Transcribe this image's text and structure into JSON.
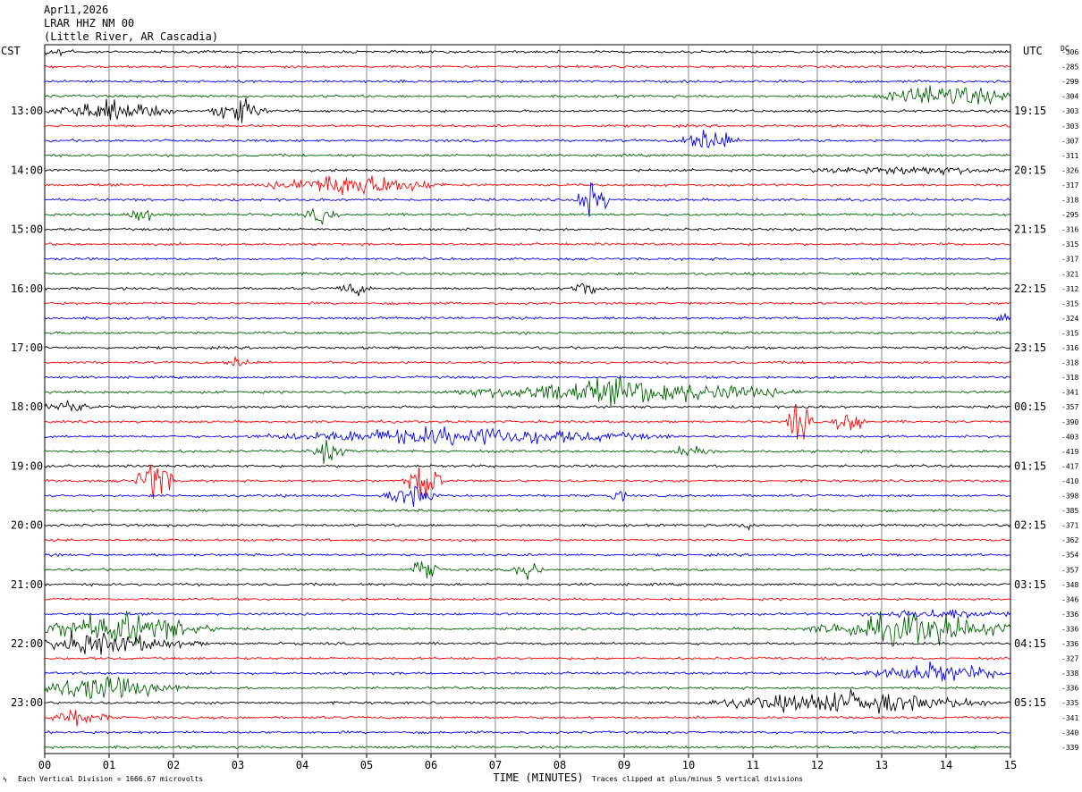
{
  "header": {
    "date": "Apr11,2026",
    "station": "LRAR HHZ NM 00",
    "location": "(Little River, AR Cascadia)"
  },
  "left_label": "CST",
  "right_label": "UTC",
  "dc_label": "DC",
  "footer": {
    "scale_note": "Each Vertical Division = 1666.67 microvolts",
    "clip_note": "Traces clipped at plus/minus 5 vertical divisions"
  },
  "chart_data": {
    "type": "line",
    "title": "Apr11,2026 LRAR HHZ NM 00 (Little River, AR Cascadia)",
    "xlabel": "TIME (MINUTES)",
    "x_ticks": [
      "00",
      "01",
      "02",
      "03",
      "04",
      "05",
      "06",
      "07",
      "08",
      "09",
      "10",
      "11",
      "12",
      "13",
      "14",
      "15"
    ],
    "xlim": [
      0,
      15
    ],
    "grid": true,
    "trace_colors": [
      "#000000",
      "#ff0000",
      "#0000ff",
      "#006400"
    ],
    "left_time_labels": [
      "13:00",
      "14:00",
      "15:00",
      "16:00",
      "17:00",
      "18:00",
      "19:00",
      "20:00",
      "21:00",
      "22:00",
      "23:00"
    ],
    "right_time_labels": [
      "19:15",
      "20:15",
      "21:15",
      "22:15",
      "23:15",
      "00:15",
      "01:15",
      "02:15",
      "03:15",
      "04:15",
      "05:15"
    ],
    "dc_offsets": [
      "-306",
      "-285",
      "-299",
      "-304",
      "-303",
      "-303",
      "-307",
      "-311",
      "-326",
      "-317",
      "-318",
      "-295",
      "-316",
      "-315",
      "-317",
      "-321",
      "-312",
      "-315",
      "-324",
      "-315",
      "-316",
      "-318",
      "-318",
      "-341",
      "-357",
      "-390",
      "-403",
      "-419",
      "-417",
      "-410",
      "-398",
      "-385",
      "-371",
      "-362",
      "-354",
      "-357",
      "-348",
      "-346",
      "-336",
      "-336",
      "-336",
      "-327",
      "-338",
      "-336",
      "-335",
      "-341",
      "-340",
      "-339"
    ],
    "events": [
      {
        "trace": 0,
        "minute": 0.2,
        "amp": 0.35,
        "width": 0.3
      },
      {
        "trace": 3,
        "minute": 14.0,
        "amp": 0.8,
        "width": 1.2
      },
      {
        "trace": 4,
        "minute": 1.0,
        "amp": 0.7,
        "width": 1.2
      },
      {
        "trace": 4,
        "minute": 3.0,
        "amp": 0.9,
        "width": 0.5
      },
      {
        "trace": 6,
        "minute": 10.3,
        "amp": 1.0,
        "width": 0.5
      },
      {
        "trace": 8,
        "minute": 13.5,
        "amp": 0.25,
        "width": 2.0
      },
      {
        "trace": 9,
        "minute": 4.8,
        "amp": 0.8,
        "width": 1.5
      },
      {
        "trace": 10,
        "minute": 8.5,
        "amp": 1.6,
        "width": 0.3
      },
      {
        "trace": 11,
        "minute": 1.5,
        "amp": 0.55,
        "width": 0.3
      },
      {
        "trace": 11,
        "minute": 4.3,
        "amp": 0.55,
        "width": 0.3
      },
      {
        "trace": 16,
        "minute": 4.8,
        "amp": 0.5,
        "width": 0.3
      },
      {
        "trace": 16,
        "minute": 8.4,
        "amp": 0.6,
        "width": 0.3
      },
      {
        "trace": 18,
        "minute": 14.9,
        "amp": 0.45,
        "width": 0.15
      },
      {
        "trace": 21,
        "minute": 3.0,
        "amp": 0.45,
        "width": 0.25
      },
      {
        "trace": 23,
        "minute": 9.0,
        "amp": 0.85,
        "width": 3.0
      },
      {
        "trace": 24,
        "minute": 0.3,
        "amp": 0.45,
        "width": 0.5
      },
      {
        "trace": 25,
        "minute": 11.7,
        "amp": 1.6,
        "width": 0.25
      },
      {
        "trace": 25,
        "minute": 12.5,
        "amp": 1.0,
        "width": 0.3
      },
      {
        "trace": 26,
        "minute": 6.5,
        "amp": 0.6,
        "width": 3.5
      },
      {
        "trace": 27,
        "minute": 4.4,
        "amp": 0.7,
        "width": 0.35
      },
      {
        "trace": 27,
        "minute": 10.1,
        "amp": 0.6,
        "width": 0.35
      },
      {
        "trace": 29,
        "minute": 1.7,
        "amp": 1.7,
        "width": 0.35
      },
      {
        "trace": 29,
        "minute": 5.9,
        "amp": 1.4,
        "width": 0.35
      },
      {
        "trace": 30,
        "minute": 5.7,
        "amp": 0.7,
        "width": 0.5
      },
      {
        "trace": 30,
        "minute": 8.9,
        "amp": 0.35,
        "width": 0.2
      },
      {
        "trace": 32,
        "minute": 10.9,
        "amp": 0.25,
        "width": 0.15
      },
      {
        "trace": 35,
        "minute": 5.9,
        "amp": 1.0,
        "width": 0.25
      },
      {
        "trace": 35,
        "minute": 7.5,
        "amp": 0.6,
        "width": 0.3
      },
      {
        "trace": 38,
        "minute": 14.0,
        "amp": 0.3,
        "width": 1.5
      },
      {
        "trace": 39,
        "minute": 1.2,
        "amp": 1.1,
        "width": 1.6
      },
      {
        "trace": 39,
        "minute": 13.5,
        "amp": 1.1,
        "width": 1.8
      },
      {
        "trace": 40,
        "minute": 0.8,
        "amp": 0.7,
        "width": 1.8
      },
      {
        "trace": 42,
        "minute": 13.8,
        "amp": 0.6,
        "width": 1.4
      },
      {
        "trace": 43,
        "minute": 0.8,
        "amp": 0.8,
        "width": 1.5
      },
      {
        "trace": 44,
        "minute": 12.5,
        "amp": 0.75,
        "width": 2.5
      },
      {
        "trace": 45,
        "minute": 0.5,
        "amp": 0.5,
        "width": 0.6
      }
    ]
  }
}
